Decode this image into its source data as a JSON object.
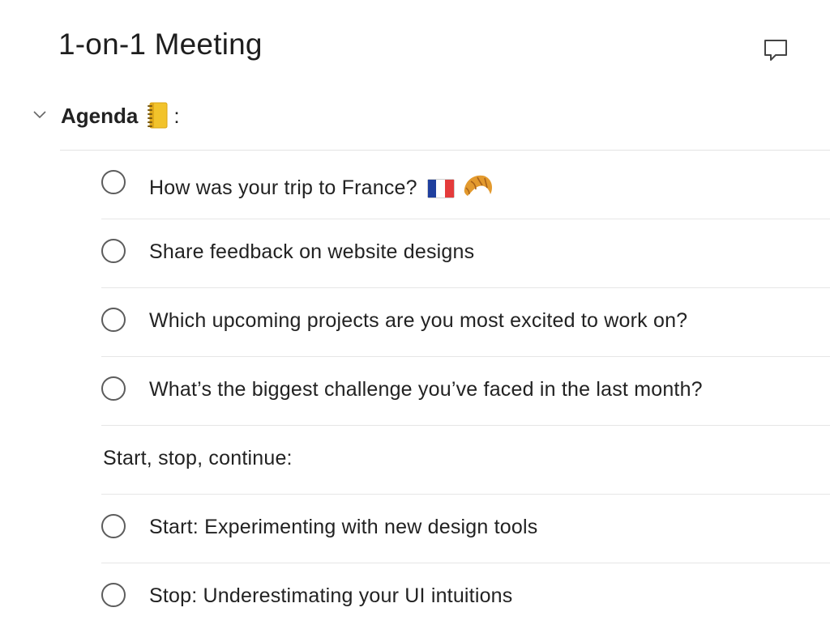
{
  "title": "1-on-1 Meeting",
  "section": {
    "label": "Agenda",
    "emoji": "notebook-icon",
    "suffix": ":"
  },
  "rows": [
    {
      "type": "task",
      "text": "How was your trip to France?",
      "emojis": [
        "france-flag-icon",
        "croissant-icon"
      ]
    },
    {
      "type": "task",
      "text": "Share feedback on website designs"
    },
    {
      "type": "task",
      "text": "Which upcoming projects are you most excited to work on?"
    },
    {
      "type": "task",
      "text": "What’s the biggest challenge you’ve faced in the last month?"
    },
    {
      "type": "heading",
      "text": "Start, stop, continue:"
    },
    {
      "type": "task",
      "text": "Start: Experimenting with new design tools"
    },
    {
      "type": "task",
      "text": "Stop: Underestimating your UI intuitions"
    }
  ],
  "colors": {
    "text": "#222222",
    "divider": "#e6e6e6",
    "checkbox_border": "#5c5c5c",
    "notebook": "#f2c32b",
    "croissant": "#e39a2e",
    "flag_blue": "#1f3f9e",
    "flag_white": "#ffffff",
    "flag_red": "#e43b3b"
  }
}
